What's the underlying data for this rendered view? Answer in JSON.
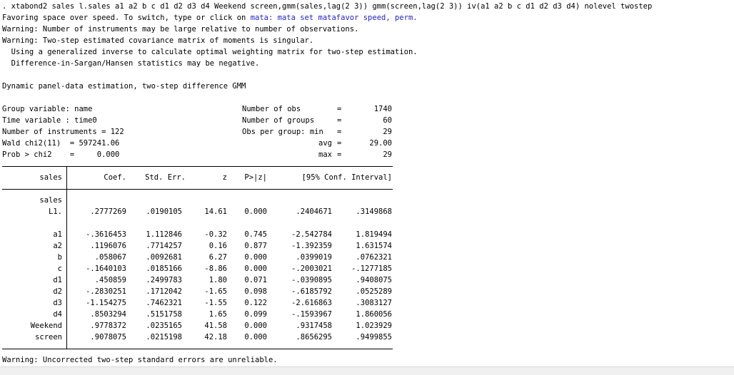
{
  "intro": {
    "command": ". xtabond2 sales l.sales a1 a2 b c d1 d2 d3 d4 Weekend screen,gmm(sales,lag(2 3)) gmm(screen,lag(2 3)) iv(a1 a2 b c d1 d2 d3 d4) nolevel twostep",
    "favoring_prefix": "Favoring space over speed. To switch, type or click on ",
    "favoring_link": "mata: mata set matafavor speed, perm.",
    "warn1": "Warning: Number of instruments may be large relative to number of observations.",
    "warn2": "Warning: Two-step estimated covariance matrix of moments is singular.",
    "note1": "  Using a generalized inverse to calculate optimal weighting matrix for two-step estimation.",
    "note2": "  Difference-in-Sargan/Hansen statistics may be negative."
  },
  "title": "Dynamic panel-data estimation, two-step difference GMM",
  "info": {
    "left": [
      "Group variable: name",
      "Time variable : time0",
      "Number of instruments = 122",
      "Wald chi2(11)  = 597241.06",
      "Prob > chi2    =     0.000"
    ],
    "right_labels": [
      "Number of obs",
      "Number of groups",
      "Obs per group: min",
      "avg",
      "max"
    ],
    "right_values": [
      "1740",
      "60",
      "29",
      "29.00",
      "29"
    ]
  },
  "table": {
    "depvar": "sales",
    "headers": [
      "Coef.",
      "Std. Err.",
      "z",
      "P>|z|",
      "[95% Conf. Interval]"
    ],
    "section": "sales",
    "rows": [
      [
        "L1.",
        ".2777269",
        ".0190105",
        "14.61",
        "0.000",
        ".2404671",
        ".3149868"
      ],
      [
        "a1",
        "-.3616453",
        "1.112846",
        "-0.32",
        "0.745",
        "-2.542784",
        "1.819494"
      ],
      [
        "a2",
        ".1196076",
        ".7714257",
        "0.16",
        "0.877",
        "-1.392359",
        "1.631574"
      ],
      [
        "b",
        ".058067",
        ".0092681",
        "6.27",
        "0.000",
        ".0399019",
        ".0762321"
      ],
      [
        "c",
        "-.1640103",
        ".0185166",
        "-8.86",
        "0.000",
        "-.2003021",
        "-.1277185"
      ],
      [
        "d1",
        ".450859",
        ".2499783",
        "1.80",
        "0.071",
        "-.0390895",
        ".9408075"
      ],
      [
        "d2",
        "-.2830251",
        ".1712042",
        "-1.65",
        "0.098",
        "-.6185792",
        ".0525289"
      ],
      [
        "d3",
        "-1.154275",
        ".7462321",
        "-1.55",
        "0.122",
        "-2.616863",
        ".3083127"
      ],
      [
        "d4",
        ".8503294",
        ".5151758",
        "1.65",
        "0.099",
        "-.1593967",
        "1.860056"
      ],
      [
        "Weekend",
        ".9778372",
        ".0235165",
        "41.58",
        "0.000",
        ".9317458",
        "1.023929"
      ],
      [
        "screen",
        ".9078075",
        ".0215198",
        "42.18",
        "0.000",
        ".8656295",
        ".9499855"
      ]
    ]
  },
  "footer_warning": "Warning: Uncorrected two-step standard errors are unreliable."
}
